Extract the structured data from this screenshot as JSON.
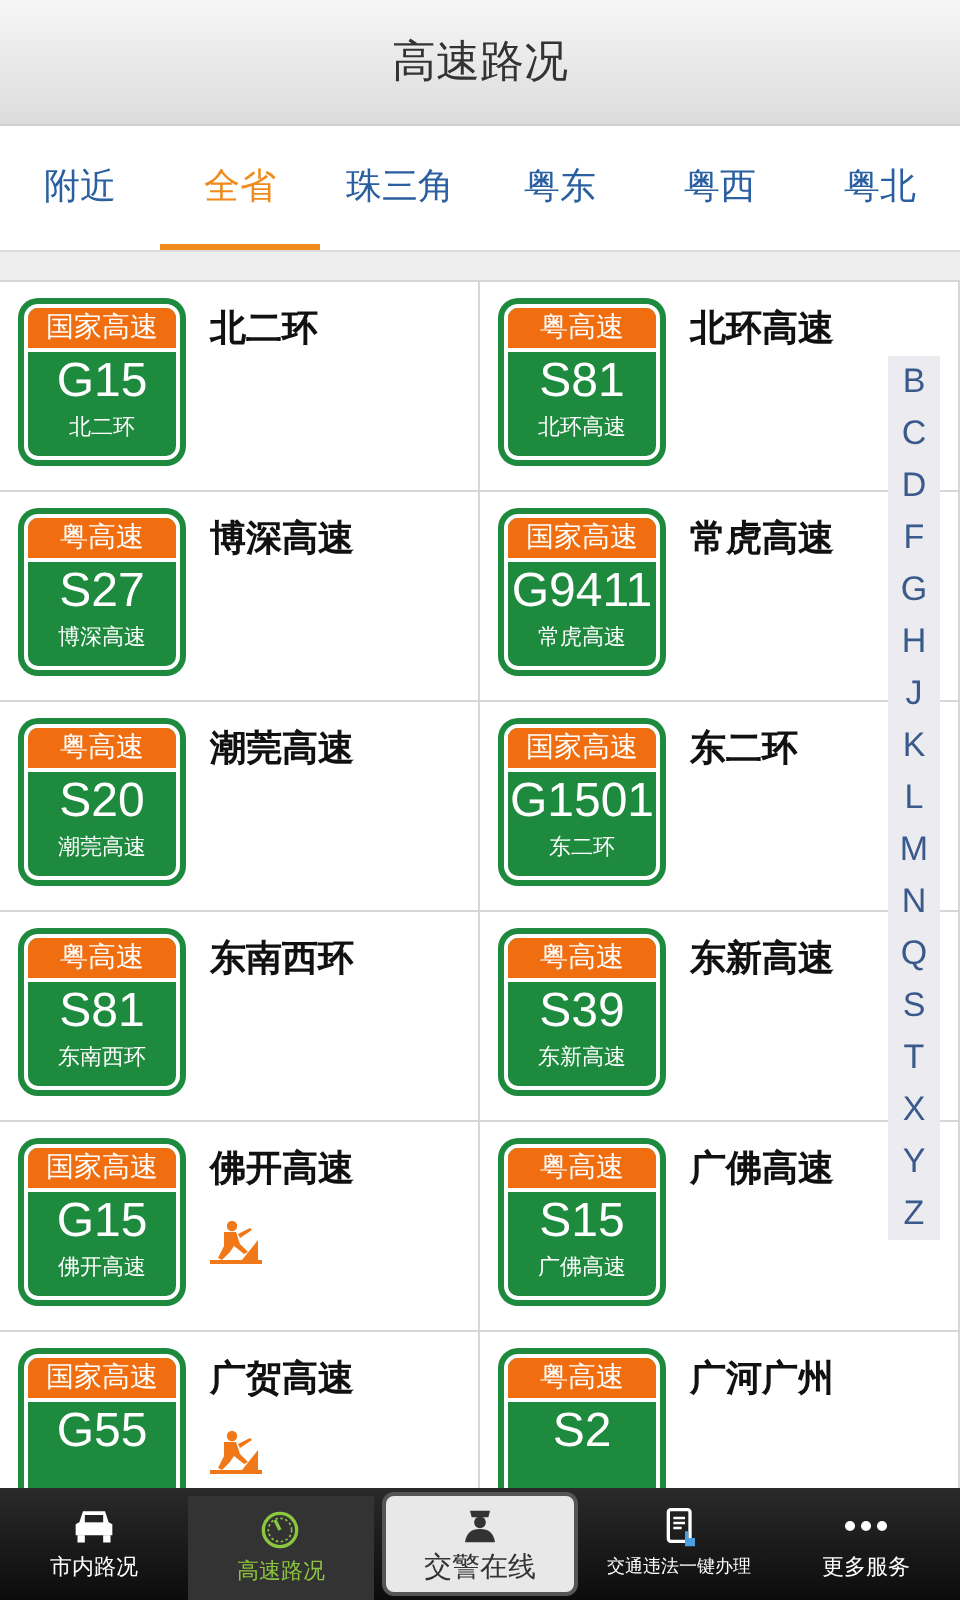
{
  "title": "高速路况",
  "tabs": [
    {
      "label": "附近",
      "selected": false
    },
    {
      "label": "全省",
      "selected": true
    },
    {
      "label": "珠三角",
      "selected": false
    },
    {
      "label": "粤东",
      "selected": false
    },
    {
      "label": "粤西",
      "selected": false
    },
    {
      "label": "粤北",
      "selected": false
    }
  ],
  "roads": [
    {
      "sign_header": "国家高速",
      "code": "G15",
      "sign_subtitle": "北二环",
      "name": "北二环",
      "construction": false
    },
    {
      "sign_header": "粤高速",
      "code": "S81",
      "sign_subtitle": "北环高速",
      "name": "北环高速",
      "construction": false
    },
    {
      "sign_header": "粤高速",
      "code": "S27",
      "sign_subtitle": "博深高速",
      "name": "博深高速",
      "construction": false
    },
    {
      "sign_header": "国家高速",
      "code": "G9411",
      "sign_subtitle": "常虎高速",
      "name": "常虎高速",
      "construction": false
    },
    {
      "sign_header": "粤高速",
      "code": "S20",
      "sign_subtitle": "潮莞高速",
      "name": "潮莞高速",
      "construction": false
    },
    {
      "sign_header": "国家高速",
      "code": "G1501",
      "sign_subtitle": "东二环",
      "name": "东二环",
      "construction": false
    },
    {
      "sign_header": "粤高速",
      "code": "S81",
      "sign_subtitle": "东南西环",
      "name": "东南西环",
      "construction": false
    },
    {
      "sign_header": "粤高速",
      "code": "S39",
      "sign_subtitle": "东新高速",
      "name": "东新高速",
      "construction": false
    },
    {
      "sign_header": "国家高速",
      "code": "G15",
      "sign_subtitle": "佛开高速",
      "name": "佛开高速",
      "construction": true
    },
    {
      "sign_header": "粤高速",
      "code": "S15",
      "sign_subtitle": "广佛高速",
      "name": "广佛高速",
      "construction": false
    },
    {
      "sign_header": "国家高速",
      "code": "G55",
      "name": "广贺高速",
      "construction": true
    },
    {
      "sign_header": "粤高速",
      "code": "S2",
      "name": "广河广州",
      "construction": false
    }
  ],
  "index_letters": [
    "B",
    "C",
    "D",
    "F",
    "G",
    "H",
    "J",
    "K",
    "L",
    "M",
    "N",
    "Q",
    "S",
    "T",
    "X",
    "Y",
    "Z"
  ],
  "nav": [
    {
      "kind": "car",
      "label": "市内路况",
      "selected": false
    },
    {
      "kind": "gauge",
      "label": "高速路况",
      "selected": true
    },
    {
      "kind": "officer",
      "label": "交警在线",
      "selected": false
    },
    {
      "kind": "tablet",
      "label": "交通违法一键办理",
      "selected": false
    },
    {
      "kind": "dots",
      "label": "更多服务",
      "selected": false
    }
  ]
}
